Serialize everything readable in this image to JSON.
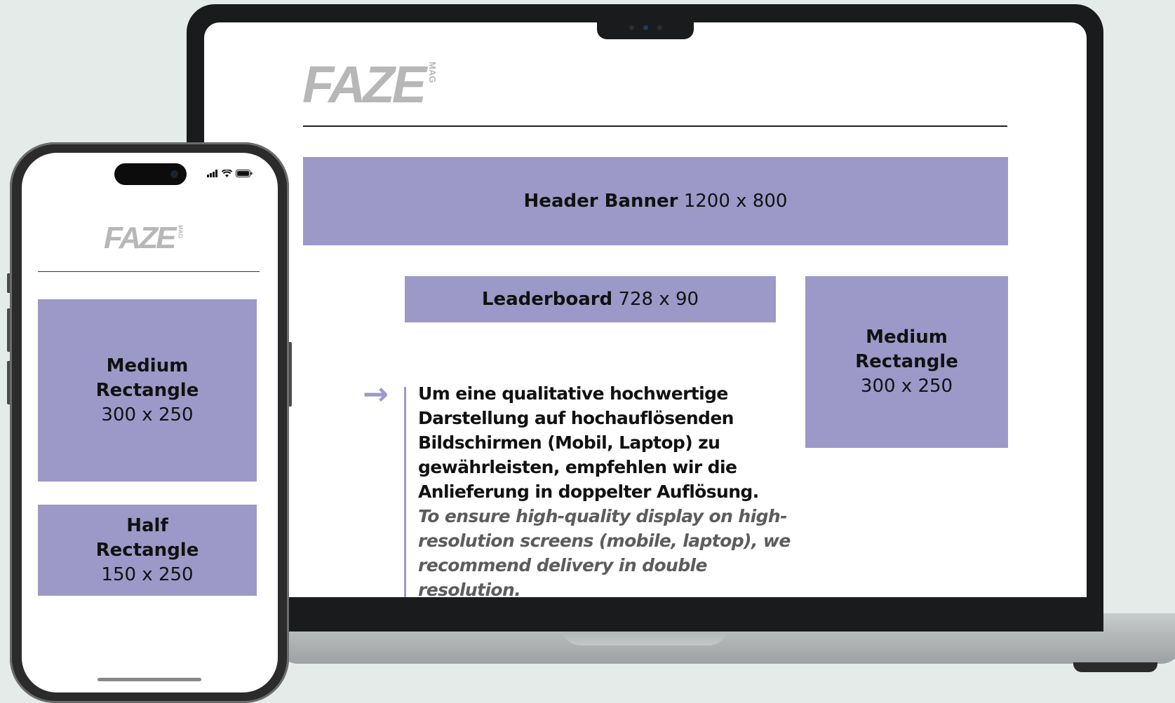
{
  "brand": {
    "logo_text": "FAZE",
    "logo_suffix": "MAG"
  },
  "laptop": {
    "header_banner": {
      "name": "Header Banner",
      "size": "1200 x 800"
    },
    "leaderboard": {
      "name": "Leaderboard",
      "size": "728 x 90"
    },
    "medium_rectangle": {
      "name_line1": "Medium",
      "name_line2": "Rectangle",
      "size": "300 x 250"
    },
    "note": {
      "arrow": "→",
      "de_lines": [
        "Um eine qualitative hochwertige",
        "Darstellung auf hochauflösenden",
        "Bildschirmen (Mobil, Laptop) zu",
        "gewährleisten, empfehlen wir die",
        "Anlieferung in doppelter Auflösung."
      ],
      "en_lines": [
        "To ensure high-quality display on high-",
        "resolution screens (mobile, laptop), we",
        "recommend delivery in double resolution."
      ]
    }
  },
  "phone": {
    "status_icons": [
      "signal-icon",
      "wifi-icon",
      "battery-icon"
    ],
    "medium_rectangle": {
      "name_line1": "Medium",
      "name_line2": "Rectangle",
      "size": "300 x 250"
    },
    "half_rectangle": {
      "name_line1": "Half",
      "name_line2": "Rectangle",
      "size": "150 x 250"
    }
  },
  "colors": {
    "ad_fill": "#9c99c8",
    "logo_gray": "#b7b7b7",
    "background": "#e4ebe8",
    "device_frame": "#1a1b1c"
  }
}
